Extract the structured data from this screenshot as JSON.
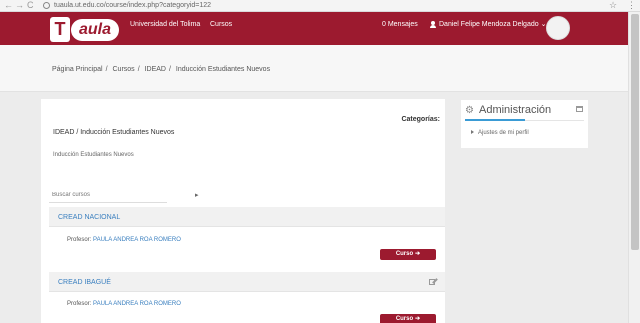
{
  "browser": {
    "url": "tuaula.ut.edu.co/course/index.php?categoryid=122",
    "back_glyph": "←",
    "forward_glyph": "→",
    "reload_glyph": "C",
    "star_glyph": "☆",
    "menu_glyph": "⋮"
  },
  "header": {
    "logo_letter": "T",
    "logo_text": "aula",
    "university": "Universidad del Tolima",
    "courses": "Cursos",
    "messages": "0 Mensajes",
    "user": "Daniel Felipe Mendoza Delgado",
    "user_caret": "⌄",
    "brand_color": "#9c1a2f"
  },
  "breadcrumb": {
    "items": [
      "Página Principal",
      "Cursos",
      "IDEAD",
      "Inducción Estudiantes Nuevos"
    ],
    "separator": "/"
  },
  "main": {
    "categories_label": "Categorías:",
    "category_title": "IDEAD / Inducción Estudiantes Nuevos",
    "category_description": "Inducción Estudiantes Nuevos",
    "search_placeholder": "Buscar cursos",
    "search_go": "▸",
    "courses": [
      {
        "name": "CREAD NACIONAL",
        "teacher_label": "Profesor: ",
        "teacher": "PAULA ANDREA ROA ROMERO",
        "button": "Curso",
        "button_arrow": "➔"
      },
      {
        "name": "CREAD IBAGUÉ",
        "teacher_label": "Profesor: ",
        "teacher": "PAULA ANDREA ROA ROMERO",
        "button": "Curso",
        "button_arrow": "➔"
      }
    ]
  },
  "admin": {
    "icon": "gear-icon",
    "icon_glyph": "⚙",
    "title": "Administración",
    "item": "Ajustes de mi perfil",
    "accent_color": "#3a9bd5"
  }
}
